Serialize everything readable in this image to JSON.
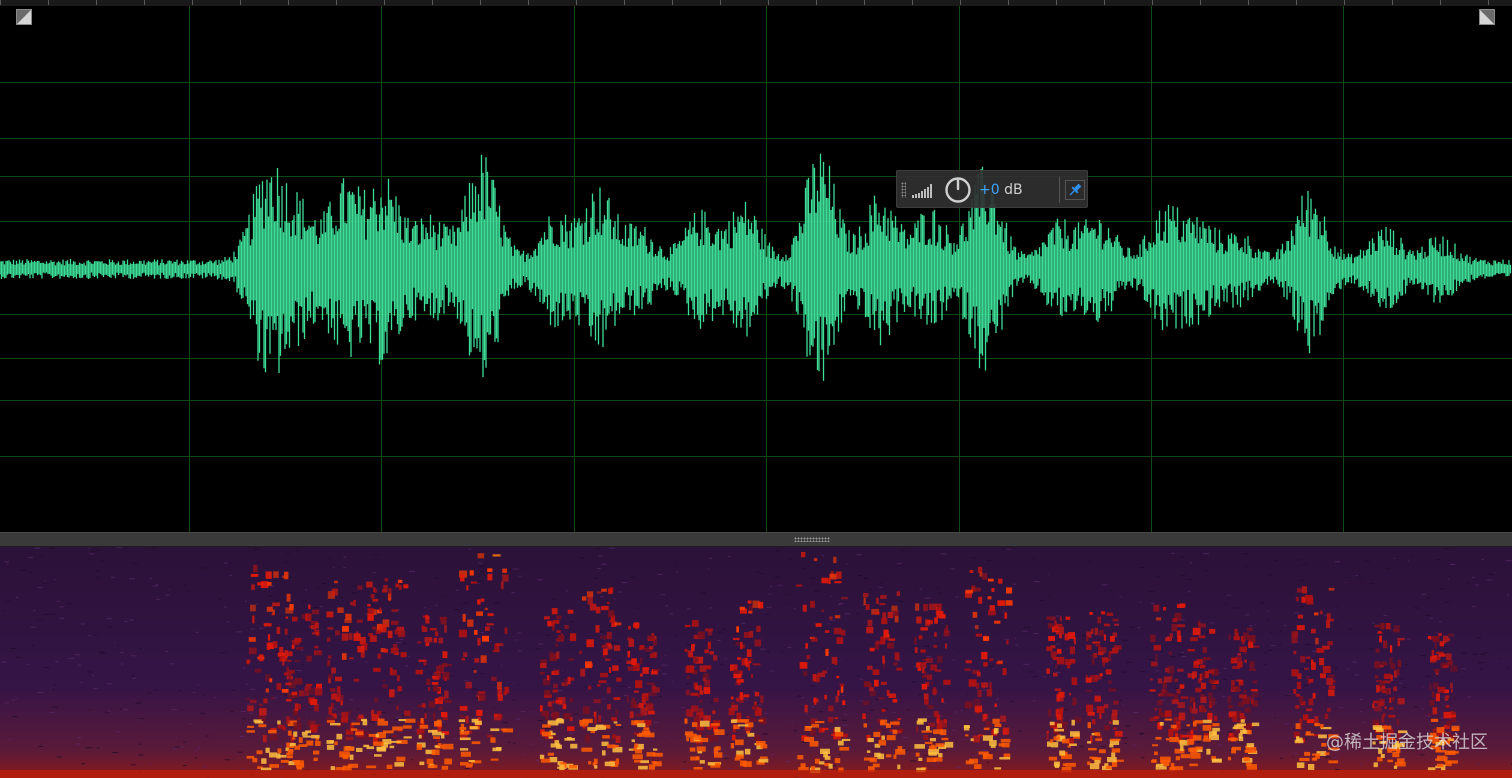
{
  "hud": {
    "gain_sign_value": "+0",
    "gain_unit": "dB"
  },
  "colors": {
    "waveform": "#3ddc97",
    "grid": "#0f4a12",
    "hud_value": "#3ea6ff",
    "spectral_low": "#2a1234",
    "spectral_high": "#ff2a00"
  },
  "icons": [
    "zoom-corner-icon",
    "level-meter-icon",
    "gain-knob-icon",
    "pin-icon",
    "resize-grip-icon"
  ],
  "watermark": "@稀土掘金技术社区"
}
